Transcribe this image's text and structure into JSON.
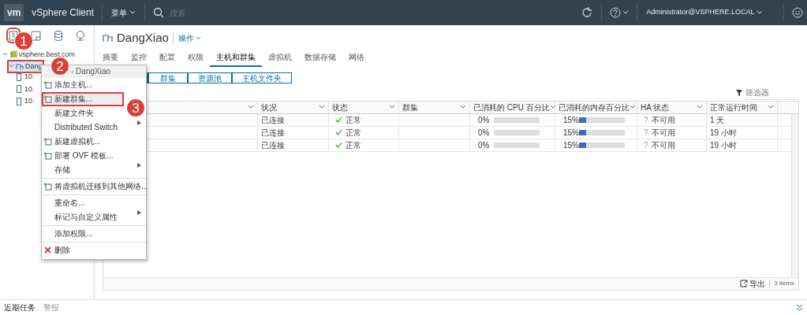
{
  "header": {
    "logo": "vm",
    "app_name": "vSphere Client",
    "menu": "菜单",
    "search_placeholder": "搜索",
    "user": "Administrator@VSPHERE.LOCAL"
  },
  "sidebar": {
    "view_icons": [
      {
        "selected": true
      },
      {
        "selected": false
      },
      {
        "selected": false
      },
      {
        "selected": false
      }
    ],
    "tree": [
      {
        "label": "vsphere.best.com",
        "expanded": true,
        "children": [
          {
            "label": "Dang",
            "expanded": true,
            "selected": true,
            "children": [
              {
                "label": "10."
              },
              {
                "label": "10."
              },
              {
                "label": "10."
              }
            ]
          }
        ]
      }
    ]
  },
  "page": {
    "title": "DangXiao",
    "actions": "操作",
    "tabs": [
      {
        "label": "摘要",
        "selected": false
      },
      {
        "label": "监控",
        "selected": false
      },
      {
        "label": "配置",
        "selected": false
      },
      {
        "label": "权限",
        "selected": false
      },
      {
        "label": "主机和群集",
        "selected": true
      },
      {
        "label": "虚拟机",
        "selected": false
      },
      {
        "label": "数据存储",
        "selected": false
      },
      {
        "label": "网络",
        "selected": false
      }
    ],
    "segments": [
      {
        "selected": true
      },
      {
        "label": "群集",
        "selected": false
      },
      {
        "label": "资源池",
        "selected": false
      },
      {
        "label": "主机文件夹",
        "selected": false
      }
    ],
    "filter_placeholder": "筛选器",
    "table": {
      "columns": [
        "状况",
        "状态",
        "群集",
        "已消耗的 CPU 百分比",
        "已消耗的内存百分比",
        "HA 状态",
        "正常运行时间"
      ],
      "rows": [
        {
          "condition": "已连接",
          "status": "正常",
          "cpu": "0%",
          "cpu_bar": {
            "level": 0
          },
          "memory": "15%",
          "memory_bar": {
            "level": 0.15
          },
          "ha_icon": "?",
          "ha": "不可用",
          "uptime": "1 天"
        },
        {
          "condition": "已连接",
          "status": "正常",
          "cpu": "0%",
          "cpu_bar": {
            "level": 0
          },
          "memory": "15%",
          "memory_bar": {
            "level": 0.15
          },
          "ha_icon": "?",
          "ha": "不可用",
          "uptime": "19 小时"
        },
        {
          "condition": "已连接",
          "status": "正常",
          "cpu": "0%",
          "cpu_bar": {
            "level": 0
          },
          "memory": "15%",
          "memory_bar": {
            "level": 0.15
          },
          "ha_icon": "?",
          "ha": "不可用",
          "uptime": "19 小时"
        }
      ],
      "export": "导出",
      "count": "3 items"
    }
  },
  "context_menu": {
    "title": "- DangXiao",
    "items": [
      {
        "kind": "item",
        "label": "添加主机...",
        "icon": true,
        "submenu": false,
        "highlighted": false
      },
      {
        "kind": "item",
        "label": "新建群集...",
        "icon": true,
        "submenu": false,
        "highlighted": true
      },
      {
        "kind": "item",
        "label": "新建文件夹",
        "icon": false,
        "submenu": false,
        "highlighted": false
      },
      {
        "kind": "item",
        "label": "Distributed Switch",
        "icon": false,
        "submenu": true,
        "highlighted": false
      },
      {
        "kind": "item",
        "label": "新建虚拟机...",
        "icon": true,
        "submenu": false,
        "highlighted": false
      },
      {
        "kind": "item",
        "label": "部署 OVF 模板...",
        "icon": true,
        "submenu": false,
        "highlighted": false
      },
      {
        "kind": "item",
        "label": "存储",
        "icon": false,
        "submenu": true,
        "highlighted": false
      },
      {
        "kind": "separator"
      },
      {
        "kind": "item",
        "label": "将虚拟机迁移到其他网络...",
        "icon": true,
        "submenu": false,
        "highlighted": false
      },
      {
        "kind": "separator"
      },
      {
        "kind": "item",
        "label": "重命名...",
        "icon": false,
        "submenu": false,
        "highlighted": false
      },
      {
        "kind": "item",
        "label": "标记与自定义属性",
        "icon": false,
        "submenu": true,
        "highlighted": false
      },
      {
        "kind": "separator"
      },
      {
        "kind": "item",
        "label": "添加权限...",
        "icon": false,
        "submenu": false,
        "highlighted": false
      },
      {
        "kind": "separator"
      },
      {
        "kind": "delete",
        "label": "删除",
        "icon": true,
        "submenu": false,
        "highlighted": false
      }
    ]
  },
  "callouts": [
    {
      "number": "1"
    },
    {
      "number": "2"
    },
    {
      "number": "3"
    }
  ],
  "bottom_bar": {
    "tabs": [
      {
        "label": "近期任务",
        "selected": true
      },
      {
        "label": "警报",
        "selected": false
      }
    ]
  }
}
